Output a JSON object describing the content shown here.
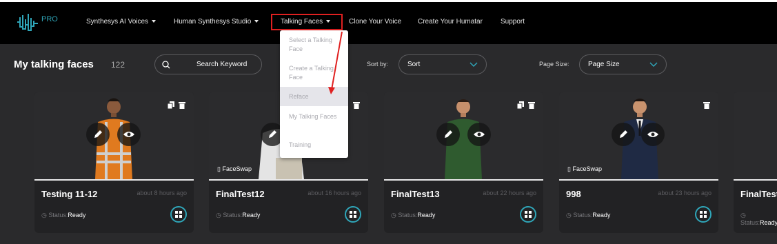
{
  "header": {
    "logo_text": "PRO",
    "nav": [
      {
        "label": "Synthesys AI Voices",
        "has_caret": true
      },
      {
        "label": "Human Synthesys Studio",
        "has_caret": true
      },
      {
        "label": "Talking Faces",
        "has_caret": true
      },
      {
        "label": "Clone Your Voice",
        "has_caret": false
      },
      {
        "label": "Create Your Humatar",
        "has_caret": false
      },
      {
        "label": "Support",
        "has_caret": false
      }
    ]
  },
  "dropdown": {
    "items": [
      "Select a Talking Face",
      "Create a Talking Face",
      "Reface",
      "My Talking Faces",
      "Training"
    ],
    "hovered_index": 2
  },
  "toolbar": {
    "title": "My talking faces",
    "count": "122",
    "search_placeholder": "Search Keyword",
    "sort_label": "Sort by:",
    "sort_value": "Sort",
    "page_size_label": "Page Size:",
    "page_size_value": "Page Size"
  },
  "cards": [
    {
      "name": "Testing 11-12",
      "time": "about 8 hours ago",
      "status_label": "Status:",
      "status": "Ready",
      "faceswap": "",
      "copy_icon": true
    },
    {
      "name": "FinalTest12",
      "time": "about 16 hours ago",
      "status_label": "Status:",
      "status": "Ready",
      "faceswap": "FaceSwap",
      "copy_icon": false
    },
    {
      "name": "FinalTest13",
      "time": "about 22 hours ago",
      "status_label": "Status:",
      "status": "Ready",
      "faceswap": "",
      "copy_icon": true
    },
    {
      "name": "998",
      "time": "about 23 hours ago",
      "status_label": "Status:",
      "status": "Ready",
      "faceswap": "FaceSwap",
      "copy_icon": false
    },
    {
      "name": "FinalTest",
      "time": "",
      "status_label": "Status:",
      "status": "Ready",
      "faceswap": "",
      "copy_icon": false
    }
  ],
  "colors": {
    "accent": "#2fa6b9",
    "highlight": "#e02020",
    "background": "#2a2a2c",
    "card": "#222224"
  }
}
